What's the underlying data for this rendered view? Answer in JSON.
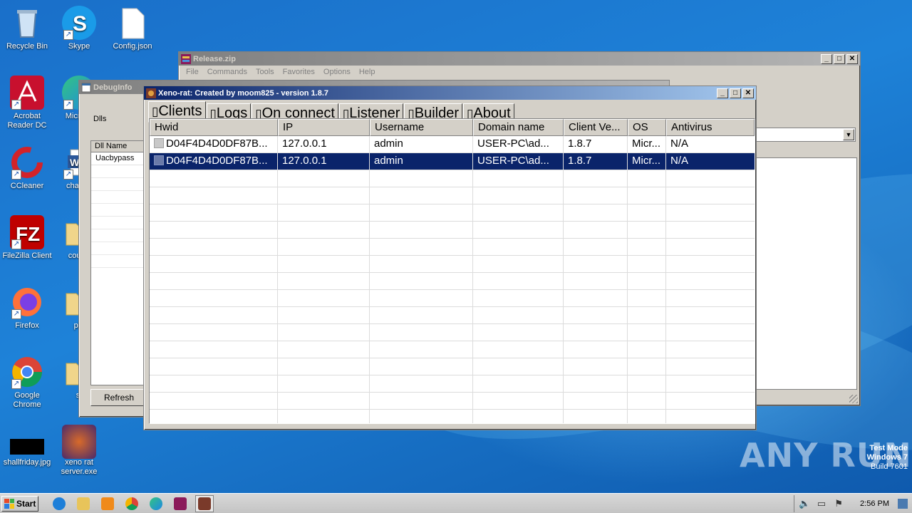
{
  "desktop_icons": [
    {
      "label": "Recycle Bin",
      "icon": "recycle-bin-icon"
    },
    {
      "label": "Skype",
      "icon": "skype-icon"
    },
    {
      "label": "Config.json",
      "icon": "file-icon"
    },
    {
      "label": "Acrobat Reader DC",
      "icon": "acrobat-icon"
    },
    {
      "label": "Microso",
      "icon": "edge-icon"
    },
    {
      "label": "CCleaner",
      "icon": "ccleaner-icon"
    },
    {
      "label": "change",
      "icon": "word-icon"
    },
    {
      "label": "FileZilla Client",
      "icon": "filezilla-icon"
    },
    {
      "label": "countr",
      "icon": "folder-icon"
    },
    {
      "label": "Firefox",
      "icon": "firefox-icon"
    },
    {
      "label": "plu",
      "icon": "folder-icon"
    },
    {
      "label": "Google Chrome",
      "icon": "chrome-icon"
    },
    {
      "label": "st",
      "icon": "folder-icon"
    },
    {
      "label": "shallfriday.jpg",
      "icon": "image-file-icon"
    },
    {
      "label": "xeno rat server.exe",
      "icon": "xeno-exe-icon"
    }
  ],
  "release_window": {
    "title": "Release.zip",
    "menu": [
      "File",
      "Commands",
      "Tools",
      "Favorites",
      "Options",
      "Help"
    ]
  },
  "debug_window": {
    "title": "DebugInfo",
    "dlls_label": "Dlls",
    "column": "Dll Name",
    "rows": [
      "Uacbypass"
    ],
    "refresh_label": "Refresh"
  },
  "xeno_window": {
    "title": "Xeno-rat: Created by moom825 - version 1.8.7",
    "tabs": [
      "Clients",
      "Logs",
      "On connect",
      "Listener",
      "Builder",
      "About"
    ],
    "active_tab": "Clients",
    "columns": [
      "Hwid",
      "IP",
      "Username",
      "Domain name",
      "Client Ve...",
      "OS",
      "Antivirus"
    ],
    "rows": [
      {
        "hwid": "D04F4D4D0DF87B...",
        "ip": "127.0.0.1",
        "username": "admin",
        "domain": "USER-PC\\ad...",
        "version": "1.8.7",
        "os": "Micr...",
        "antivirus": "N/A",
        "selected": false
      },
      {
        "hwid": "D04F4D4D0DF87B...",
        "ip": "127.0.0.1",
        "username": "admin",
        "domain": "USER-PC\\ad...",
        "version": "1.8.7",
        "os": "Micr...",
        "antivirus": "N/A",
        "selected": true
      }
    ]
  },
  "taskbar": {
    "start_label": "Start",
    "clock": "2:56 PM",
    "apps": [
      "ie-icon",
      "explorer-icon",
      "media-player-icon",
      "chrome-icon",
      "edge-icon",
      "winrar-icon",
      "xeno-rat-icon"
    ]
  },
  "watermark": {
    "brand": "ANY RUN",
    "line1": "Test Mode",
    "line2": "Windows 7",
    "line3": "Build 7601"
  }
}
